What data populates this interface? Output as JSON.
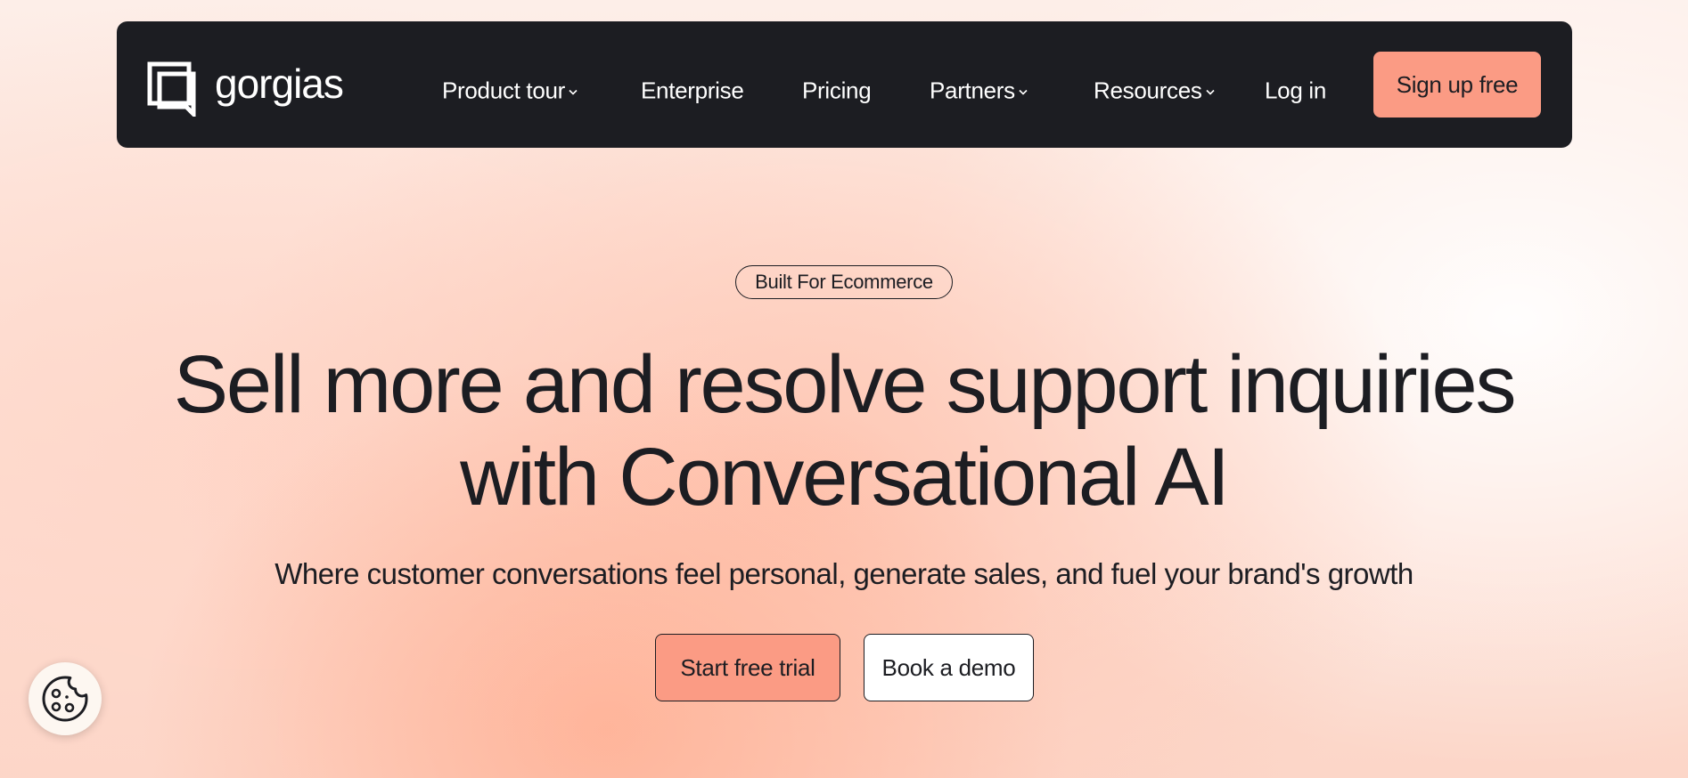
{
  "nav": {
    "logo_text": "gorgias",
    "items": [
      {
        "label": "Product tour",
        "has_dropdown": true
      },
      {
        "label": "Enterprise",
        "has_dropdown": false
      },
      {
        "label": "Pricing",
        "has_dropdown": false
      },
      {
        "label": "Partners",
        "has_dropdown": true
      },
      {
        "label": "Resources",
        "has_dropdown": true
      },
      {
        "label": "Log in",
        "has_dropdown": false
      }
    ],
    "signup_label": "Sign up free"
  },
  "hero": {
    "badge": "Built For Ecommerce",
    "title_line1": "Sell more and resolve support inquiries",
    "title_line2": "with Conversational AI",
    "subtitle": "Where customer conversations feel personal, generate sales, and fuel your brand's growth",
    "primary_cta": "Start free trial",
    "secondary_cta": "Book a demo"
  },
  "icons": {
    "logo": "gorgias-logo-icon",
    "dropdown": "chevron-down-icon",
    "cookie": "cookie-icon"
  },
  "colors": {
    "nav_bg": "#1c1d22",
    "accent": "#fb9b84",
    "text": "#1c1d22"
  }
}
